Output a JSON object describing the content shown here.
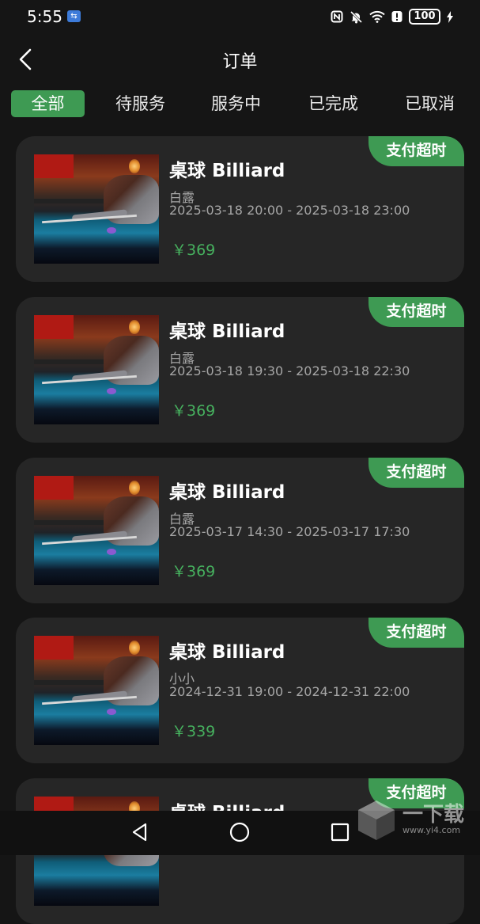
{
  "status_bar": {
    "time": "5:55",
    "usb_icon": "usb-icon",
    "icons": [
      "nfc-icon",
      "mute-icon",
      "wifi-icon",
      "alert-icon"
    ],
    "battery": "100"
  },
  "header": {
    "title": "订单",
    "back_icon": "chevron-left-icon"
  },
  "tabs": [
    {
      "label": "全部",
      "active": true
    },
    {
      "label": "待服务",
      "active": false
    },
    {
      "label": "服务中",
      "active": false
    },
    {
      "label": "已完成",
      "active": false
    },
    {
      "label": "已取消",
      "active": false
    }
  ],
  "orders": [
    {
      "title": "桌球 Billiard",
      "status": "支付超时",
      "name": "白露",
      "time": "2025-03-18 20:00 - 2025-03-18 23:00",
      "price": "￥369"
    },
    {
      "title": "桌球 Billiard",
      "status": "支付超时",
      "name": "白露",
      "time": "2025-03-18 19:30 - 2025-03-18 22:30",
      "price": "￥369"
    },
    {
      "title": "桌球 Billiard",
      "status": "支付超时",
      "name": "白露",
      "time": "2025-03-17 14:30 - 2025-03-17 17:30",
      "price": "￥369"
    },
    {
      "title": "桌球 Billiard",
      "status": "支付超时",
      "name": "小小",
      "time": "2024-12-31 19:00 - 2024-12-31 22:00",
      "price": "￥339"
    },
    {
      "title": "桌球 Billiard",
      "status": "支付超时"
    }
  ],
  "nav": {
    "icons": [
      "back-triangle-icon",
      "home-circle-icon",
      "recents-square-icon"
    ]
  },
  "watermark": {
    "big": "一下载",
    "small": "www.yi4.com"
  },
  "colors": {
    "accent": "#3e9a53",
    "price": "#46b05e",
    "background": "#151515",
    "card": "#262626"
  }
}
